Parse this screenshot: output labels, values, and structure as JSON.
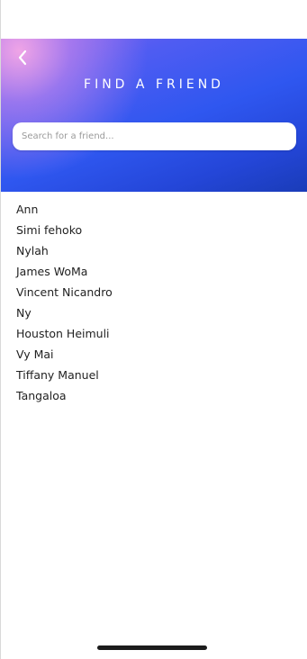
{
  "header": {
    "title": "FIND A FRIEND",
    "back_icon": "chevron-left-icon"
  },
  "search": {
    "placeholder": "Search for a friend...",
    "value": ""
  },
  "friends": [
    "Ann",
    "Simi fehoko",
    "Nylah",
    "James WoMa",
    "Vincent Nicandro",
    "Ny",
    "Houston Heimuli",
    "Vy Mai",
    "Tiffany Manuel",
    "Tangaloa"
  ],
  "colors": {
    "gradient_start": "#f6a8e6",
    "gradient_mid": "#2f57f0",
    "gradient_end": "#1a3cb8",
    "text": "#222222"
  }
}
